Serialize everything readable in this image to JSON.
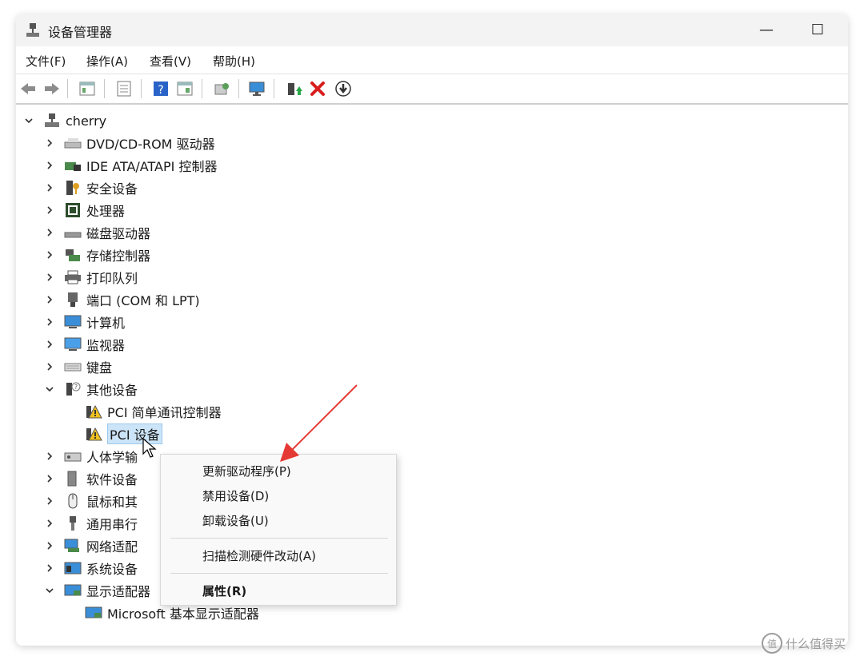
{
  "window": {
    "title": "设备管理器",
    "minimize": "—",
    "maximize": "☐"
  },
  "menu": [
    "文件(F)",
    "操作(A)",
    "查看(V)",
    "帮助(H)"
  ],
  "toolbar_icons": [
    "back-arrow-icon",
    "forward-arrow-icon",
    "properties-icon",
    "list-view-icon",
    "help-icon",
    "resources-icon",
    "scan-hardware-icon",
    "monitor-icon",
    "update-driver-icon",
    "uninstall-icon",
    "download-icon"
  ],
  "tree": {
    "root": "cherry",
    "items": [
      "DVD/CD-ROM 驱动器",
      "IDE ATA/ATAPI 控制器",
      "安全设备",
      "处理器",
      "磁盘驱动器",
      "存储控制器",
      "打印队列",
      "端口 (COM 和 LPT)",
      "计算机",
      "监视器",
      "键盘",
      "其他设备",
      "PCI 简单通讯控制器",
      "PCI 设备",
      "人体学输",
      "软件设备",
      "鼠标和其",
      "通用串行",
      "网络适配",
      "系统设备",
      "显示适配器",
      "Microsoft 基本显示适配器"
    ]
  },
  "context_menu": {
    "items": [
      "更新驱动程序(P)",
      "禁用设备(D)",
      "卸载设备(U)",
      "扫描检测硬件改动(A)",
      "属性(R)"
    ]
  },
  "watermark": {
    "text": "什么值得买",
    "logo": "值"
  },
  "colors": {
    "selection": "#cce4f7",
    "accent": "#e53935",
    "folder": "#2a7fd4"
  }
}
